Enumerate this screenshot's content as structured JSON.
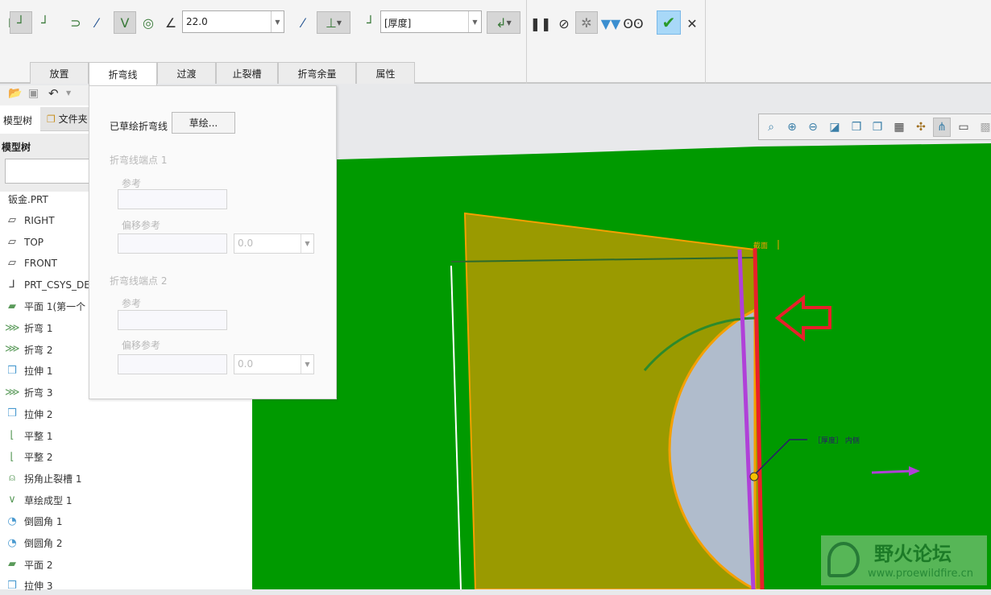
{
  "ribbon": {
    "angle_value": "22.0",
    "thickness_value": "[厚度]",
    "tabs": [
      "放置",
      "折弯线",
      "过渡",
      "止裂槽",
      "折弯余量",
      "属性"
    ],
    "active_tab": "折弯线",
    "icons": [
      "bend-placement-icon",
      "bend-placement-selected-icon",
      "bend-edge-icon",
      "flip-icon",
      "flip-direction-icon",
      "bend-angle-icon",
      "bend-roll-icon",
      "angle-icon",
      "flip-side-icon",
      "bend-dimension-icon",
      "thickness-side-icon",
      "bend-radius-icon",
      "pause-icon",
      "no-preview-icon",
      "preview-geometry-icon",
      "verify-icon",
      "glasses-icon",
      "confirm-icon",
      "cancel-icon"
    ]
  },
  "left": {
    "tabs": [
      "模型树",
      "文件夹"
    ],
    "tree_title": "模型树",
    "search_value": "",
    "root": "钣金.PRT",
    "items": [
      {
        "label": "RIGHT",
        "icon": "datum-plane-icon"
      },
      {
        "label": "TOP",
        "icon": "datum-plane-icon"
      },
      {
        "label": "FRONT",
        "icon": "datum-plane-icon"
      },
      {
        "label": "PRT_CSYS_DE",
        "icon": "csys-icon"
      },
      {
        "label": "平面 1(第一个",
        "icon": "flat-wall-icon"
      },
      {
        "label": "折弯 1",
        "icon": "bend-icon"
      },
      {
        "label": "折弯 2",
        "icon": "bend-icon"
      },
      {
        "label": "拉伸 1",
        "icon": "extrude-icon"
      },
      {
        "label": "折弯 3",
        "icon": "bend-icon"
      },
      {
        "label": "拉伸 2",
        "icon": "extrude-icon"
      },
      {
        "label": "平整 1",
        "icon": "flat-icon"
      },
      {
        "label": "平整 2",
        "icon": "flat-icon"
      },
      {
        "label": "拐角止裂槽 1",
        "icon": "corner-relief-icon"
      },
      {
        "label": "草绘成型 1",
        "icon": "sketched-form-icon"
      },
      {
        "label": "倒圆角 1",
        "icon": "round-icon"
      },
      {
        "label": "倒圆角 2",
        "icon": "round-icon"
      },
      {
        "label": "平面 2",
        "icon": "flat-wall-icon"
      },
      {
        "label": "拉伸 3",
        "icon": "extrude-icon"
      }
    ]
  },
  "panel": {
    "sketched_label": "已草绘折弯线",
    "sketch_button": "草绘...",
    "endpoint1": "折弯线端点 1",
    "endpoint2": "折弯线端点 2",
    "reference": "参考",
    "offset_reference": "偏移参考",
    "offset1_value": "0.0",
    "offset2_value": "0.0"
  },
  "viewport": {
    "section_label": "截面",
    "annotation": "［厚度］ 内侧",
    "highlight_color": "#e8202a",
    "model_color": "#009a00"
  },
  "watermark": {
    "title": "野火论坛",
    "url": "www.proewildfire.cn"
  }
}
